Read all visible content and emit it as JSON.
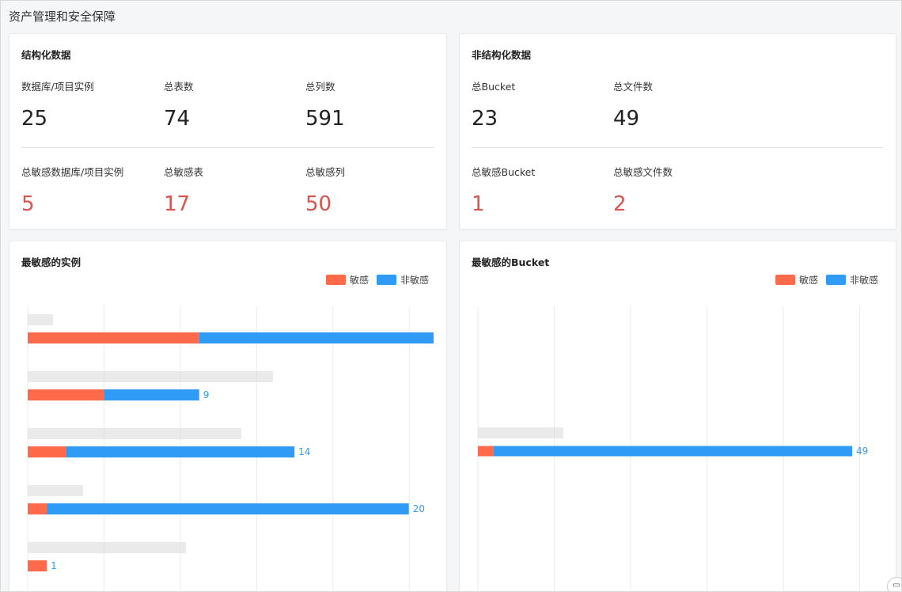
{
  "page": {
    "title": "资产管理和安全保障"
  },
  "structured": {
    "title": "结构化数据",
    "stats_top": [
      {
        "label": "数据库/项目实例",
        "value": "25"
      },
      {
        "label": "总表数",
        "value": "74"
      },
      {
        "label": "总列数",
        "value": "591"
      }
    ],
    "stats_bottom": [
      {
        "label": "总敏感数据库/项目实例",
        "value": "5"
      },
      {
        "label": "总敏感表",
        "value": "17"
      },
      {
        "label": "总敏感列",
        "value": "50"
      }
    ]
  },
  "unstructured": {
    "title": "非结构化数据",
    "stats_top": [
      {
        "label": "总Bucket",
        "value": "23"
      },
      {
        "label": "总文件数",
        "value": "49"
      }
    ],
    "stats_bottom": [
      {
        "label": "总敏感Bucket",
        "value": "1"
      },
      {
        "label": "总敏感文件数",
        "value": "2"
      }
    ]
  },
  "legend": {
    "sensitive": "敏感",
    "non_sensitive": "非敏感"
  },
  "colors": {
    "sensitive": "#ff6b4a",
    "non_sensitive": "#2f9bf7",
    "sensitive_text": "#d9534f",
    "label_text": "#2f9bf7"
  },
  "chart_data": [
    {
      "type": "bar",
      "title": "最敏感的实例",
      "orientation": "horizontal",
      "stacked": true,
      "categories": [
        "",
        "",
        "",
        "",
        ""
      ],
      "series": [
        {
          "name": "敏感",
          "values": [
            9,
            4,
            2,
            1,
            1
          ]
        },
        {
          "name": "非敏感",
          "values": [
            12.3,
            5,
            12,
            19,
            0
          ]
        }
      ],
      "data_labels": [
        "",
        "9",
        "14",
        "20",
        "1"
      ],
      "xlim": [
        0,
        21.3
      ],
      "grid": true,
      "legend": "top-right"
    },
    {
      "type": "bar",
      "title": "最敏感的Bucket",
      "orientation": "horizontal",
      "stacked": true,
      "categories": [
        ""
      ],
      "series": [
        {
          "name": "敏感",
          "values": [
            2
          ]
        },
        {
          "name": "非敏感",
          "values": [
            47
          ]
        }
      ],
      "data_labels": [
        "49"
      ],
      "xlim": [
        0,
        49
      ],
      "grid": true,
      "legend": "top-right"
    }
  ]
}
